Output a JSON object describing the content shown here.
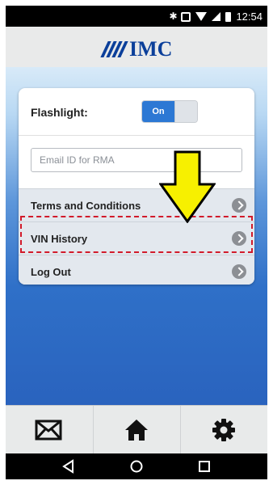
{
  "status": {
    "time": "12:54"
  },
  "header": {
    "logo_text": "IMC"
  },
  "settings": {
    "flashlight_label": "Flashlight:",
    "flashlight_state": "On",
    "email_placeholder": "Email ID for RMA",
    "email_value": ""
  },
  "menu": [
    {
      "label": "Terms and Conditions"
    },
    {
      "label": "VIN History"
    },
    {
      "label": "Log Out"
    }
  ],
  "tabs": [
    {
      "icon": "mail-icon"
    },
    {
      "icon": "home-icon"
    },
    {
      "icon": "gear-icon"
    }
  ],
  "colors": {
    "brand": "#0b3f9a",
    "highlight": "#d21b2b",
    "arrow": "#f7f000"
  }
}
